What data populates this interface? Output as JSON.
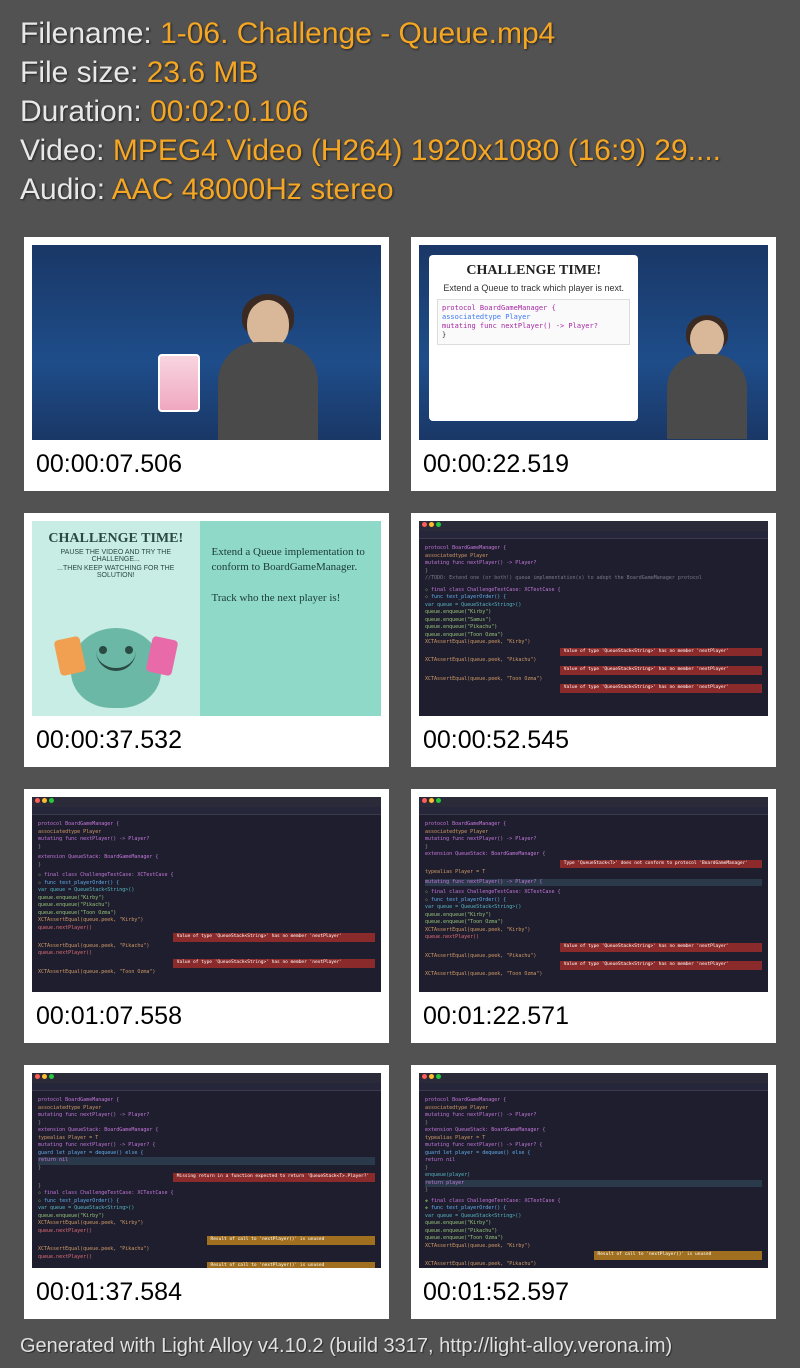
{
  "info": {
    "filename_label": "Filename: ",
    "filename_value": "1-06. Challenge - Queue.mp4",
    "filesize_label": "File size: ",
    "filesize_value": "23.6 MB",
    "duration_label": "Duration: ",
    "duration_value": "00:02:0.106",
    "video_label": "Video: ",
    "video_value": "MPEG4 Video (H264) 1920x1080 (16:9) 29....",
    "audio_label": "Audio: ",
    "audio_value": "AAC 48000Hz stereo"
  },
  "thumbs": [
    {
      "time": "00:00:07.506"
    },
    {
      "time": "00:00:22.519"
    },
    {
      "time": "00:00:37.532"
    },
    {
      "time": "00:00:52.545"
    },
    {
      "time": "00:01:07.558"
    },
    {
      "time": "00:01:22.571"
    },
    {
      "time": "00:01:37.584"
    },
    {
      "time": "00:01:52.597"
    }
  ],
  "slide2": {
    "title": "CHALLENGE TIME!",
    "sub": "Extend a Queue to track which player is next.",
    "code_l1": "protocol BoardGameManager {",
    "code_l2": "  associatedtype Player",
    "code_l3": "  mutating func nextPlayer() -> Player?",
    "code_l4": "}"
  },
  "slide3": {
    "title": "CHALLENGE TIME!",
    "sub1": "PAUSE THE VIDEO AND TRY THE CHALLENGE...",
    "sub2": "...THEN KEEP WATCHING FOR THE SOLUTION!",
    "right1": "Extend a Queue implementation to conform to BoardGameManager.",
    "right2": "Track who the next player is!"
  },
  "code": {
    "proto1": "protocol BoardGameManager {",
    "proto2": "  associatedtype Player",
    "proto3": "  mutating func nextPlayer() -> Player?",
    "proto4": "}",
    "todo": "//TODO: Extend one (or both!) queue implementation(s) to adopt the BoardGameManager protocol",
    "ext1": "extension QueueStack: BoardGameManager {",
    "ext2": "  typealias Player = T",
    "ext3": "  mutating func nextPlayer() -> Player? {",
    "ext4": "    guard let player = dequeue() else {",
    "ext5": "      return nil",
    "ext6": "    }",
    "ext7": "    enqueue(player)",
    "ext8": "    return player",
    "ext9": "  }",
    "tc1": "final class ChallengeTestCase: XCTestCase {",
    "tc2": "  func test_playerOrder() {",
    "tc3": "    var queue = QueueStack<String>()",
    "tc4": "    queue.enqueue(\"Kirby\")",
    "tc5": "    queue.enqueue(\"Samus\")",
    "tc6": "    queue.enqueue(\"Pikachu\")",
    "tc7": "    queue.enqueue(\"Toon Ozma\")",
    "tc8": "    XCTAssertEqual(queue.peek, \"Kirby\")",
    "tc9": "    queue.nextPlayer()",
    "tc10": "    XCTAssertEqual(queue.peek, \"Pikachu\")",
    "tc11": "    queue.nextPlayer()",
    "tc12": "    XCTAssertEqual(queue.peek, \"Toon Ozma\")",
    "err_nomember": "Value of type 'QueueStack<String>' has no member 'nextPlayer'",
    "err_conform": "Type 'QueueStack<T>' does not conform to protocol 'BoardGameManager'",
    "err_return": "Missing return in a function expected to return 'QueueStack<T>.Player?'",
    "warn_unused": "Result of call to 'nextPlayer()' is unused"
  },
  "footer": "Generated with Light Alloy v4.10.2 (build 3317, http://light-alloy.verona.im)"
}
